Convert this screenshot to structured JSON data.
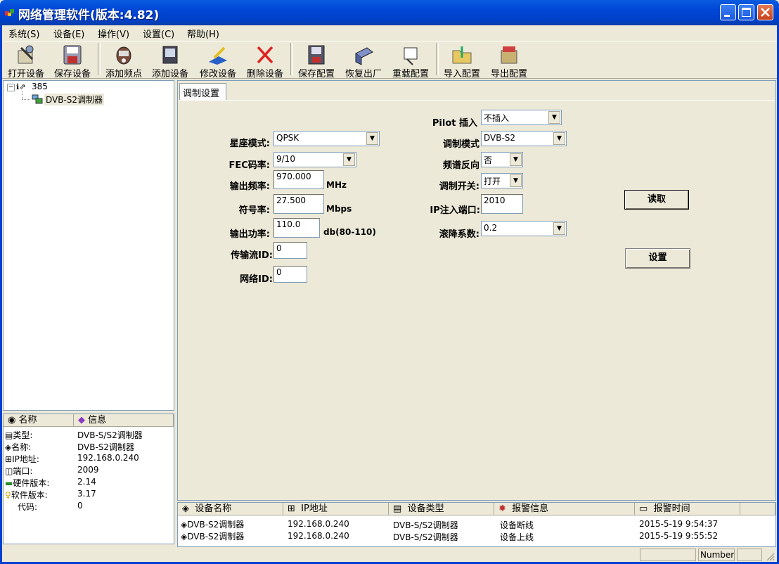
{
  "window": {
    "title": "网络管理软件(版本:4.82)"
  },
  "menu": [
    "系统(S)",
    "设备(E)",
    "操作(V)",
    "设置(C)",
    "帮助(H)"
  ],
  "toolbar": [
    "打开设备",
    "保存设备",
    "添加频点",
    "添加设备",
    "修改设备",
    "删除设备",
    "保存配置",
    "恢复出厂",
    "重载配置",
    "导入配置",
    "导出配置"
  ],
  "tree": {
    "root": "385",
    "child": "DVB-S2调制器"
  },
  "info": {
    "headers": [
      "名称",
      "信息"
    ],
    "rows": [
      {
        "k": "类型:",
        "v": "DVB-S/S2调制器"
      },
      {
        "k": "名称:",
        "v": "DVB-S2调制器"
      },
      {
        "k": "IP地址:",
        "v": "192.168.0.240"
      },
      {
        "k": "端口:",
        "v": "2009"
      },
      {
        "k": "硬件版本:",
        "v": "2.14"
      },
      {
        "k": "软件版本:",
        "v": "3.17"
      },
      {
        "k": "代码:",
        "v": "0"
      }
    ]
  },
  "tab": {
    "label": "调制设置"
  },
  "form": {
    "constellation": {
      "label": "星座模式:",
      "value": "QPSK"
    },
    "fec": {
      "label": "FEC码率:",
      "value": "9/10"
    },
    "outfreq": {
      "label": "输出频率:",
      "value": "970.000",
      "unit": "MHz"
    },
    "symrate": {
      "label": "符号率:",
      "value": "27.500",
      "unit": "Mbps"
    },
    "outpower": {
      "label": "输出功率:",
      "value": "110.0",
      "unit": "db(80-110)"
    },
    "tsid": {
      "label": "传输流ID:",
      "value": "0"
    },
    "netid": {
      "label": "网络ID:",
      "value": "0"
    },
    "pilot": {
      "label": "Pilot 插入",
      "value": "不插入"
    },
    "modmode": {
      "label": "调制模式",
      "value": "DVB-S2"
    },
    "specinv": {
      "label": "频谱反向",
      "value": "否"
    },
    "modswitch": {
      "label": "调制开关:",
      "value": "打开"
    },
    "ipport": {
      "label": "IP注入端口:",
      "value": "2010"
    },
    "rolloff": {
      "label": "滚降系数:",
      "value": "0.2"
    },
    "read_button": "读取",
    "set_button": "设置"
  },
  "alarm": {
    "headers": [
      "设备名称",
      "IP地址",
      "设备类型",
      "报警信息",
      "报警时间"
    ],
    "rows": [
      [
        "DVB-S2调制器",
        "192.168.0.240",
        "DVB-S/S2调制器",
        "设备断线",
        "2015-5-19 9:54:37"
      ],
      [
        "DVB-S2调制器",
        "192.168.0.240",
        "DVB-S/S2调制器",
        "设备上线",
        "2015-5-19 9:55:52"
      ]
    ]
  },
  "status": {
    "mode": "Number"
  }
}
